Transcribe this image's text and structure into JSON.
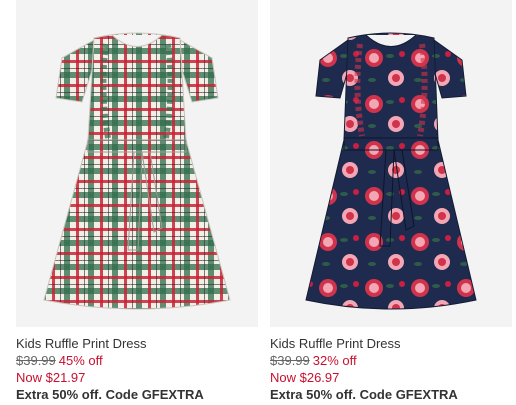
{
  "products": [
    {
      "name": "Kids Ruffle Print Dress",
      "original_price": "$39.99",
      "discount": "45% off",
      "sale_price": "Now $21.97",
      "promo": "Extra 50% off. Code GFEXTRA",
      "image_semantic": "plaid-dress-image",
      "colors": {
        "primary": "#2f6a4a",
        "accent": "#c72434",
        "base": "#f2efe8"
      }
    },
    {
      "name": "Kids Ruffle Print Dress",
      "original_price": "$39.99",
      "discount": "32% off",
      "sale_price": "Now $26.97",
      "promo": "Extra 50% off. Code GFEXTRA",
      "image_semantic": "floral-dress-image",
      "colors": {
        "primary": "#1e2b4f",
        "accent": "#d0334b",
        "base": "#f3a6b4"
      }
    }
  ],
  "theme": {
    "sale_color": "#c8102e",
    "text_color": "#333333",
    "muted_color": "#666666"
  }
}
